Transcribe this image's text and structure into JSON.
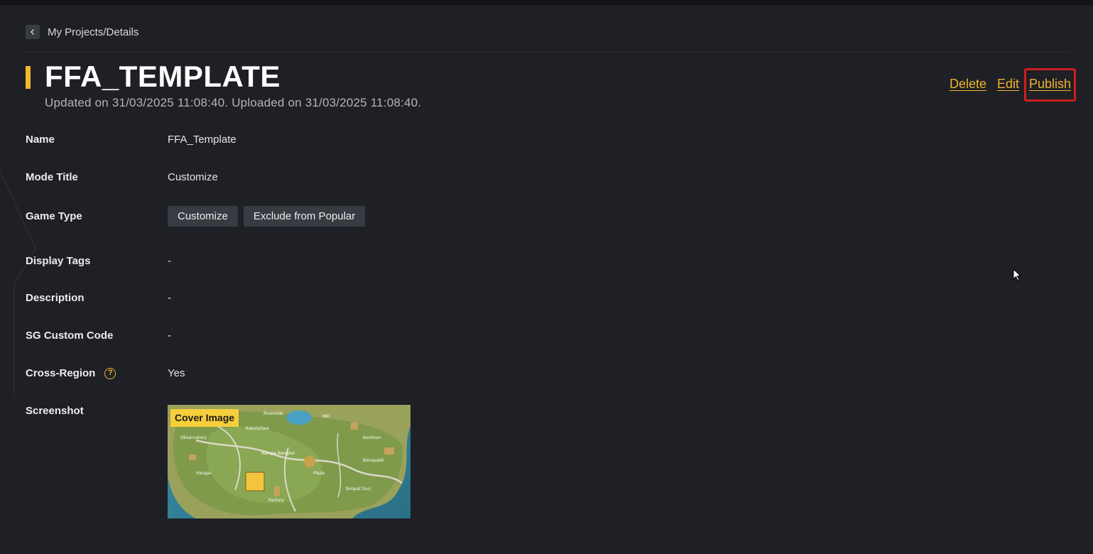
{
  "breadcrumb": {
    "text": "My Projects/Details"
  },
  "header": {
    "title": "FFA_TEMPLATE",
    "subtitle": "Updated on 31/03/2025 11:08:40. Uploaded on 31/03/2025 11:08:40."
  },
  "actions": {
    "delete": "Delete",
    "edit": "Edit",
    "publish": "Publish"
  },
  "details": {
    "name": {
      "label": "Name",
      "value": "FFA_Template"
    },
    "mode_title": {
      "label": "Mode Title",
      "value": "Customize"
    },
    "game_type": {
      "label": "Game Type",
      "tags": [
        "Customize",
        "Exclude from Popular"
      ]
    },
    "display_tags": {
      "label": "Display Tags",
      "value": "-"
    },
    "description": {
      "label": "Description",
      "value": "-"
    },
    "sg_custom_code": {
      "label": "SG Custom Code",
      "value": "-"
    },
    "cross_region": {
      "label": "Cross-Region",
      "value": "Yes",
      "help_icon": "question-circle-icon"
    },
    "screenshot": {
      "label": "Screenshot",
      "badge": "Cover Image"
    }
  },
  "map_labels": [
    "Riverside",
    "Mill",
    "Katulistiwa",
    "Observatory",
    "Kesiman",
    "Rampa Bengkel",
    "Hangar",
    "Plaza",
    "Factory",
    "Tempat Suci",
    "Bimasakti"
  ],
  "colors": {
    "background": "#1f2025",
    "accent": "#f0b42e",
    "highlight": "#cc1f1f",
    "tag_bg": "#393b42"
  }
}
